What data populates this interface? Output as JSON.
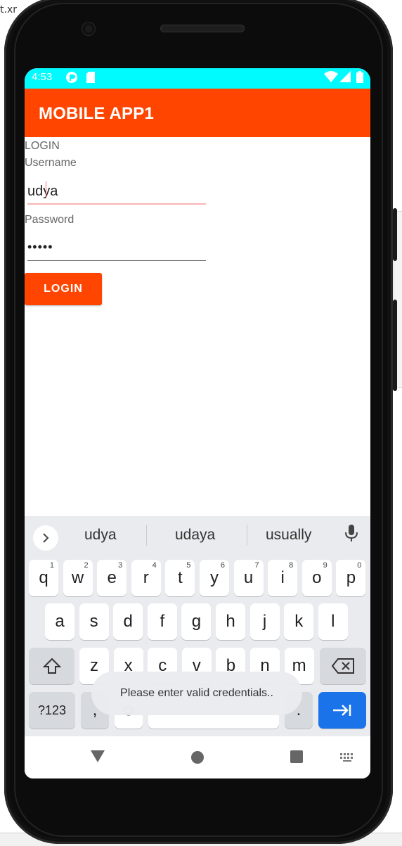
{
  "background": {
    "top_left_text": "t.xr"
  },
  "status_bar": {
    "time": "4:53",
    "color": "#00fbff"
  },
  "app_bar": {
    "title": "MOBILE APP1",
    "color": "#ff4500"
  },
  "form": {
    "heading": "LOGIN",
    "username_label": "Username",
    "username_value": "udya",
    "password_label": "Password",
    "password_value": "•••••",
    "login_button": "LOGIN"
  },
  "keyboard": {
    "suggestions": [
      "udya",
      "udaya",
      "usually"
    ],
    "row1": [
      {
        "k": "q",
        "n": "1"
      },
      {
        "k": "w",
        "n": "2"
      },
      {
        "k": "e",
        "n": "3"
      },
      {
        "k": "r",
        "n": "4"
      },
      {
        "k": "t",
        "n": "5"
      },
      {
        "k": "y",
        "n": "6"
      },
      {
        "k": "u",
        "n": "7"
      },
      {
        "k": "i",
        "n": "8"
      },
      {
        "k": "o",
        "n": "9"
      },
      {
        "k": "p",
        "n": "0"
      }
    ],
    "row2": [
      "a",
      "s",
      "d",
      "f",
      "g",
      "h",
      "j",
      "k",
      "l"
    ],
    "row3": [
      "z",
      "x",
      "c",
      "v",
      "b",
      "n",
      "m"
    ],
    "symbols_key": "?123",
    "comma_key": ",",
    "period_key": ".",
    "accent_color": "#1a73e8"
  },
  "toast": {
    "message": "Please enter valid credentials.."
  }
}
